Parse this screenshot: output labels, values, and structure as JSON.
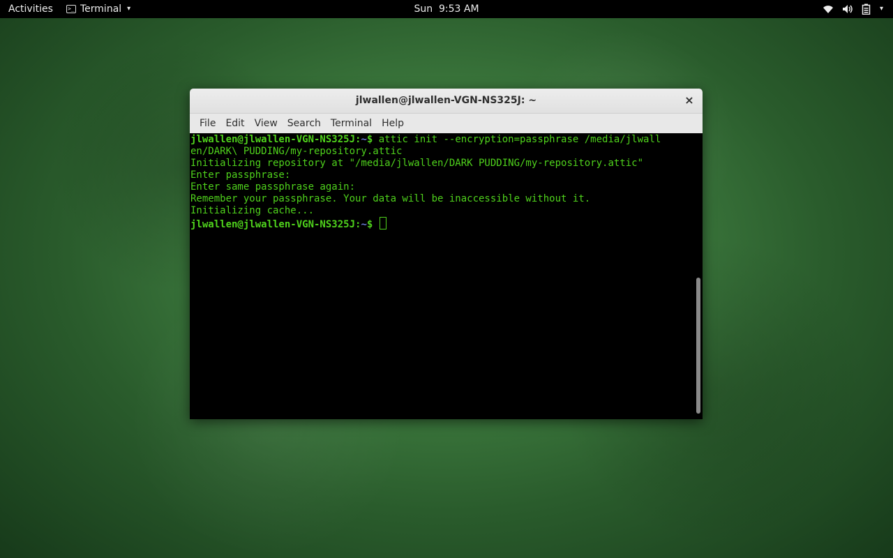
{
  "topbar": {
    "activities": "Activities",
    "app_name": "Terminal",
    "app_icon_glyph": ">_",
    "clock": "Sun  9:53 AM",
    "icons": [
      "wifi-icon",
      "volume-icon",
      "battery-icon",
      "chevron-down-icon"
    ]
  },
  "window": {
    "title": "jlwallen@jlwallen-VGN-NS325J: ~",
    "close_glyph": "×",
    "menu": [
      "File",
      "Edit",
      "View",
      "Search",
      "Terminal",
      "Help"
    ]
  },
  "terminal": {
    "prompt_user": "jlwallen@jlwallen-VGN-NS325J",
    "prompt_sep": ":",
    "prompt_path": "~",
    "prompt_symbol": "$ ",
    "command_line1": "attic init --encryption=passphrase /media/jlwall",
    "command_line2": "en/DARK\\ PUDDING/my-repository.attic",
    "output": [
      "Initializing repository at \"/media/jlwallen/DARK PUDDING/my-repository.attic\"",
      "Enter passphrase:",
      "Enter same passphrase again:",
      "Remember your passphrase. Your data will be inaccessible without it.",
      "Initializing cache..."
    ]
  },
  "colors": {
    "terminal_text": "#4fd21c",
    "terminal_path": "#6a7bd9",
    "terminal_bg": "#000000"
  }
}
